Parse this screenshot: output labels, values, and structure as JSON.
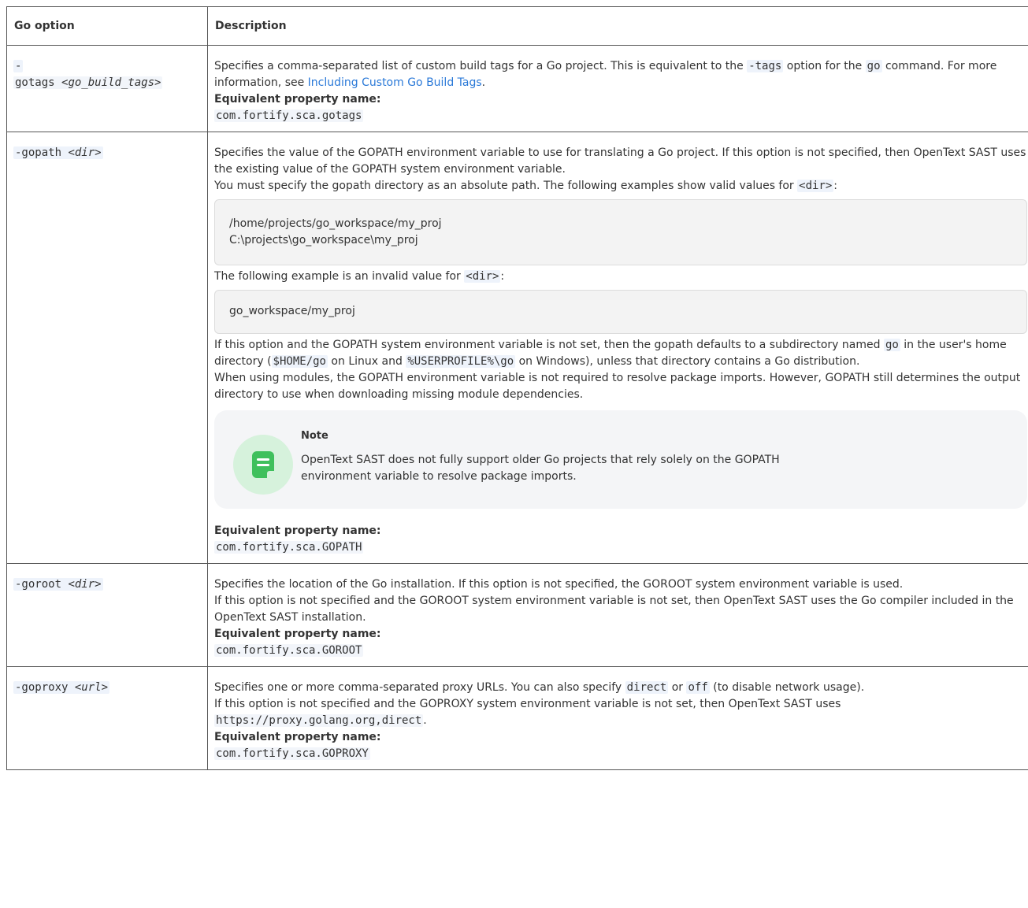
{
  "header": {
    "col1": "Go option",
    "col2": "Description"
  },
  "equiv_label": "Equivalent property name:",
  "rows": {
    "gotags": {
      "opt_dash": "-",
      "opt_name": "gotags",
      "opt_arg": "<go_build_tags>",
      "desc_a": "Specifies a comma-separated list of custom build tags for a Go project. This is equivalent to the ",
      "code_tags": "-tags",
      "desc_b": " option for the ",
      "code_go": "go",
      "desc_c": " command. For more information, see ",
      "link": "Including Custom Go Build Tags",
      "desc_d": ".",
      "prop": "com.fortify.sca.gotags"
    },
    "gopath": {
      "opt_name": "-gopath",
      "opt_arg": "<dir>",
      "p1": "Specifies the value of the GOPATH environment variable to use for translating a Go project. If this option is not specified, then OpenText SAST uses the existing value of the GOPATH system environment variable.",
      "p2": "You must specify the gopath directory as an absolute path. The following examples show valid values for ",
      "p2_code": "<dir>",
      "p2_end": ":",
      "example_valid_1": "/home/projects/go_workspace/my_proj",
      "example_valid_2": "C:\\projects\\go_workspace\\my_proj",
      "p3": "The following example is an invalid value for ",
      "p3_code": "<dir>",
      "p3_end": ":",
      "example_invalid": "go_workspace/my_proj",
      "p4_a": "If this option and the GOPATH system environment variable is not set, then the gopath defaults to a subdirectory named ",
      "p4_code1": "go",
      "p4_b": " in the user's home directory (",
      "p4_code2": "$HOME/go",
      "p4_c": " on Linux and ",
      "p4_code3": "%USERPROFILE%\\go",
      "p4_d": " on Windows), unless that directory contains a Go distribution.",
      "p5": "When using modules, the GOPATH environment variable is not required to resolve package imports. However, GOPATH still determines the output directory to use when downloading missing module dependencies.",
      "note_title": "Note",
      "note_text": "OpenText SAST does not fully support older Go projects that rely solely on the GOPATH environment variable to resolve package imports.",
      "note_icon": "note-icon",
      "prop": "com.fortify.sca.GOPATH"
    },
    "goroot": {
      "opt_name": "-goroot",
      "opt_arg": "<dir>",
      "p1": "Specifies the location of the Go installation. If this option is not specified, the GOROOT system environment variable is used.",
      "p2": "If this option is not specified and the GOROOT system environment variable is not set, then OpenText SAST uses the Go compiler included in the OpenText SAST installation.",
      "prop": "com.fortify.sca.GOROOT"
    },
    "goproxy": {
      "opt_name": "-goproxy",
      "opt_arg": "<url>",
      "p1_a": "Specifies one or more comma-separated proxy URLs. You can also specify ",
      "p1_code1": "direct",
      "p1_b": " or ",
      "p1_code2": "off",
      "p1_c": " (to disable network usage).",
      "p2": "If this option is not specified and the GOPROXY system environment variable is not set, then OpenText SAST uses ",
      "p2_code": "https://proxy.golang.org,direct",
      "p2_end": ".",
      "prop": "com.fortify.sca.GOPROXY"
    }
  }
}
